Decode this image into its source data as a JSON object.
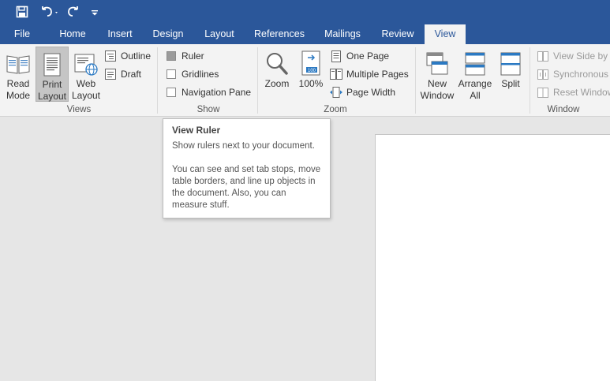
{
  "qat": {
    "save_icon": "save-icon",
    "undo_icon": "undo-icon",
    "redo_icon": "redo-icon",
    "customize_icon": "customize-qat-icon"
  },
  "tabs": [
    {
      "label": "File"
    },
    {
      "label": "Home"
    },
    {
      "label": "Insert"
    },
    {
      "label": "Design"
    },
    {
      "label": "Layout"
    },
    {
      "label": "References"
    },
    {
      "label": "Mailings"
    },
    {
      "label": "Review"
    },
    {
      "label": "View",
      "active": true
    }
  ],
  "ribbon": {
    "views": {
      "label": "Views",
      "read_mode": "Read\nMode",
      "print_layout": "Print\nLayout",
      "web_layout": "Web\nLayout",
      "outline": "Outline",
      "draft": "Draft"
    },
    "show": {
      "label": "Show",
      "ruler": "Ruler",
      "ruler_checked": true,
      "gridlines": "Gridlines",
      "gridlines_checked": false,
      "navigation_pane": "Navigation Pane",
      "navigation_pane_checked": false
    },
    "zoom": {
      "label": "Zoom",
      "zoom": "Zoom",
      "hundred": "100%",
      "one_page": "One Page",
      "multiple_pages": "Multiple Pages",
      "page_width": "Page Width"
    },
    "window": {
      "label": "Window",
      "new_window": "New\nWindow",
      "arrange_all": "Arrange\nAll",
      "split": "Split",
      "view_side_by_side": "View Side by S",
      "synchronous_scrolling": "Synchronous S",
      "reset_window": "Reset Window"
    }
  },
  "tooltip": {
    "title": "View Ruler",
    "line1": "Show rulers next to your document.",
    "line2": "You can see and set tab stops, move table borders, and line up objects in the document. Also, you can measure stuff."
  },
  "colors": {
    "title_bar": "#2b579a",
    "ribbon": "#f3f3f3",
    "workspace": "#e6e6e6",
    "page": "#ffffff"
  }
}
